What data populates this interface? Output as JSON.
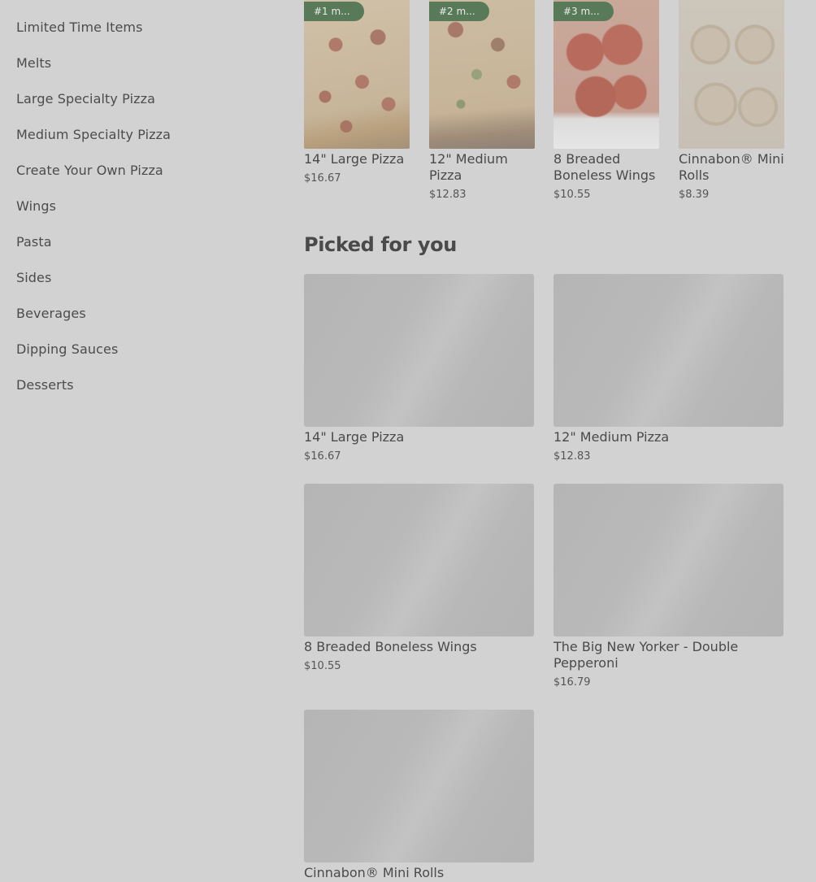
{
  "sidebar": {
    "items": [
      {
        "label": "Limited Time Items"
      },
      {
        "label": "Melts"
      },
      {
        "label": "Large Specialty Pizza"
      },
      {
        "label": "Medium Specialty Pizza"
      },
      {
        "label": "Create Your Own Pizza"
      },
      {
        "label": "Wings"
      },
      {
        "label": "Pasta"
      },
      {
        "label": "Sides"
      },
      {
        "label": "Beverages"
      },
      {
        "label": "Dipping Sauces"
      },
      {
        "label": "Desserts"
      }
    ]
  },
  "popular": {
    "items": [
      {
        "badge": "#1 m...",
        "name": "14\" Large Pizza",
        "price": "$16.67"
      },
      {
        "badge": "#2 m...",
        "name": "12\" Medium Pizza",
        "price": "$12.83"
      },
      {
        "badge": "#3 m...",
        "name": "8 Breaded Boneless Wings",
        "price": "$10.55"
      },
      {
        "badge": "",
        "name": "Cinnabon® Mini Rolls",
        "price": "$8.39"
      }
    ]
  },
  "picked_for_you": {
    "title": "Picked for you",
    "items": [
      {
        "name": "14\" Large Pizza",
        "price": "$16.67"
      },
      {
        "name": "12\" Medium Pizza",
        "price": "$12.83"
      },
      {
        "name": "8 Breaded Boneless Wings",
        "price": "$10.55"
      },
      {
        "name": "The Big New Yorker - Double Pepperoni",
        "price": "$16.79"
      },
      {
        "name": "Cinnabon® Mini Rolls",
        "price": ""
      }
    ]
  },
  "colors": {
    "background": "#d2d2d2",
    "badge": "#587a58",
    "text": "#4a4a4a",
    "image_placeholder": "#b8b8b8"
  }
}
